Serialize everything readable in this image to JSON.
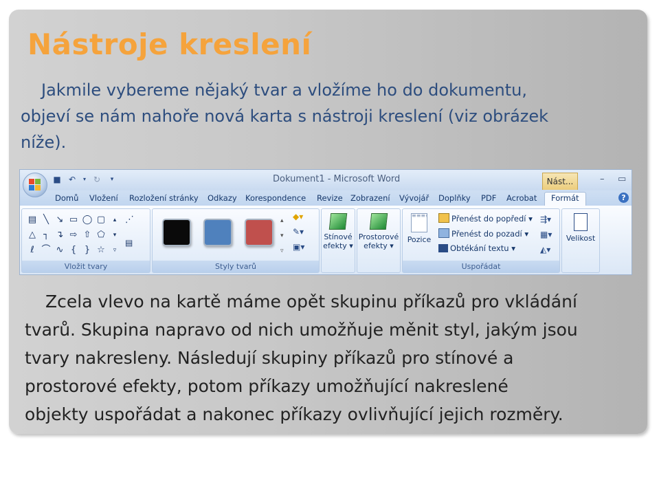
{
  "slide": {
    "title": "Nástroje kreslení",
    "para1_line1": "Jakmile vybereme nějaký tvar a vložíme ho do dokumentu,",
    "para1_line2": "objeví se nám nahoře nová karta s nástroji kreslení (viz obrázek",
    "para1_line3": "níže).",
    "para2_line1": "Zcela vlevo na kartě máme opět skupinu příkazů pro vkládání",
    "para2_line2": "tvarů. Skupina napravo od nich umožňuje měnit styl, jakým jsou",
    "para2_line3": "tvary nakresleny. Následují skupiny příkazů pro stínové a",
    "para2_line4": "prostorové efekty, potom příkazy umožňující nakreslené",
    "para2_line5": "objekty uspořádat a nakonec příkazy ovlivňující jejich rozměry."
  },
  "ribbon": {
    "window_title": "Dokument1 - Microsoft Word",
    "context_tab": "Nást...",
    "tabs": [
      "Domů",
      "Vložení",
      "Rozložení stránky",
      "Odkazy",
      "Korespondence",
      "Revize",
      "Zobrazení",
      "Vývojář",
      "Doplňky",
      "PDF",
      "Acrobat"
    ],
    "active_tab": "Formát",
    "groups": {
      "insert_shapes": "Vložit tvary",
      "shape_styles": "Styly tvarů",
      "arrange": "Uspořádat"
    },
    "buttons": {
      "shadow_line1": "Stínové",
      "shadow_line2": "efekty",
      "effects3d_line1": "Prostorové",
      "effects3d_line2": "efekty",
      "position": "Pozice",
      "bring_front": "Přenést do popředí",
      "send_back": "Přenést do pozadí",
      "text_wrap": "Obtékání textu",
      "size": "Velikost"
    },
    "style_colors": [
      "#0a0a0a",
      "#4f81bd",
      "#c0504d"
    ],
    "icons": [
      "office-button-icon",
      "save-icon",
      "undo-icon",
      "redo-icon",
      "minimize-icon",
      "maximize-icon",
      "close-icon",
      "help-icon"
    ]
  }
}
